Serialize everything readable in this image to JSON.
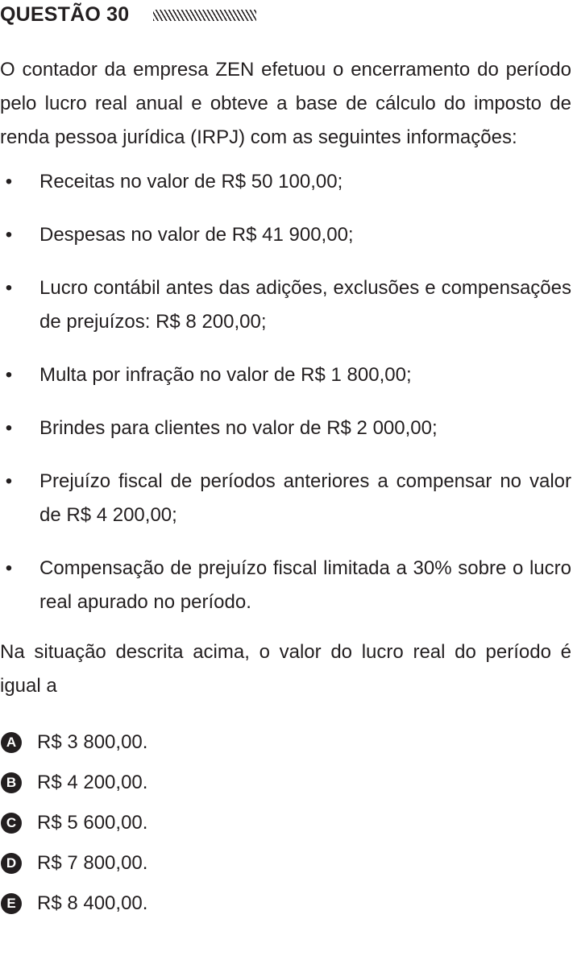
{
  "header": {
    "title": "QUESTÃO 30"
  },
  "intro": "O contador da empresa ZEN efetuou o encerramento do período pelo lucro real anual e obteve a base de cálculo do imposto de renda pessoa jurídica (IRPJ) com as seguintes informações:",
  "bullet_symbol": "•",
  "items": [
    "Receitas no valor de R$ 50 100,00;",
    "Despesas no valor de R$ 41 900,00;",
    "Lucro contábil antes das adições, exclusões e compensações de prejuízos: R$ 8 200,00;",
    "Multa por infração no valor de R$ 1 800,00;",
    "Brindes para clientes no valor de R$ 2 000,00;",
    "Prejuízo fiscal de períodos anteriores a compensar no valor de R$ 4 200,00;",
    "Compensação de prejuízo fiscal limitada a 30% sobre o lucro real apurado no período."
  ],
  "question": "Na situação descrita acima, o valor do lucro real do período é igual a",
  "options": [
    {
      "letter": "A",
      "text": "R$ 3 800,00."
    },
    {
      "letter": "B",
      "text": "R$ 4 200,00."
    },
    {
      "letter": "C",
      "text": "R$ 5 600,00."
    },
    {
      "letter": "D",
      "text": "R$ 7 800,00."
    },
    {
      "letter": "E",
      "text": "R$ 8 400,00."
    }
  ]
}
